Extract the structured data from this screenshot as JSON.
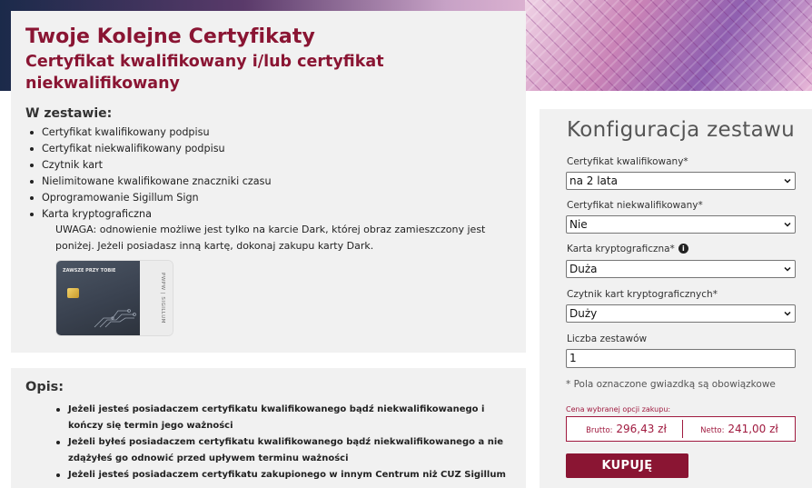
{
  "product": {
    "title": "Twoje Kolejne Certyfikaty",
    "subtitle": "Certyfikat kwalifikowany i/lub certyfikat niekwalifikowany",
    "set_heading": "W zestawie:",
    "set_items": [
      "Certyfikat kwalifikowany podpisu",
      "Certyfikat niekwalifikowany podpisu",
      "Czytnik kart",
      "Nielimitowane kwalifikowane znaczniki czasu",
      "Oprogramowanie Sigillum Sign",
      "Karta kryptograficzna"
    ],
    "note": "UWAGA: odnowienie możliwe jest tylko na karcie Dark, której obraz zamieszczony jest poniżej. Jeżeli posiadasz inną kartę, dokonaj zakupu karty Dark.",
    "card_image": {
      "tagline": "ZAWSZE PRZY TOBIE",
      "brand": "PWPW | SIGILLUM"
    }
  },
  "description": {
    "heading": "Opis:",
    "items": [
      "Jeżeli jesteś posiadaczem certyfikatu kwalifikowanego bądź niekwalifikowanego i kończy się termin jego ważności",
      "Jeżeli byłeś posiadaczem certyfikatu kwalifikowanego bądź niekwalifikowanego a nie zdążyłeś go odnowić przed upływem terminu ważności",
      "Jeżeli jesteś posiadaczem certyfikatu zakupionego w innym Centrum niż CUZ Sigillum"
    ]
  },
  "config": {
    "title": "Konfiguracja zestawu",
    "fields": [
      {
        "label": "Certyfikat kwalifikowany*",
        "value": "na 2 lata"
      },
      {
        "label": "Certyfikat niekwalifikowany*",
        "value": "Nie"
      },
      {
        "label": "Karta kryptograficzna*",
        "value": "Duża"
      },
      {
        "label": "Czytnik kart kryptograficznych*",
        "value": "Duży"
      }
    ],
    "quantity_label": "Liczba zestawów",
    "quantity_value": "1",
    "required_note": "* Pola oznaczone gwiazdką są obowiązkowe",
    "price_label": "Cena wybranej opcji zakupu:",
    "gross_label": "Brutto:",
    "gross_value": "296,43 zł",
    "net_label": "Netto:",
    "net_value": "241,00 zł",
    "buy_label": "KUPUJĘ"
  },
  "colors": {
    "brand": "#8a1533",
    "panel_bg": "#f1f1f1"
  }
}
